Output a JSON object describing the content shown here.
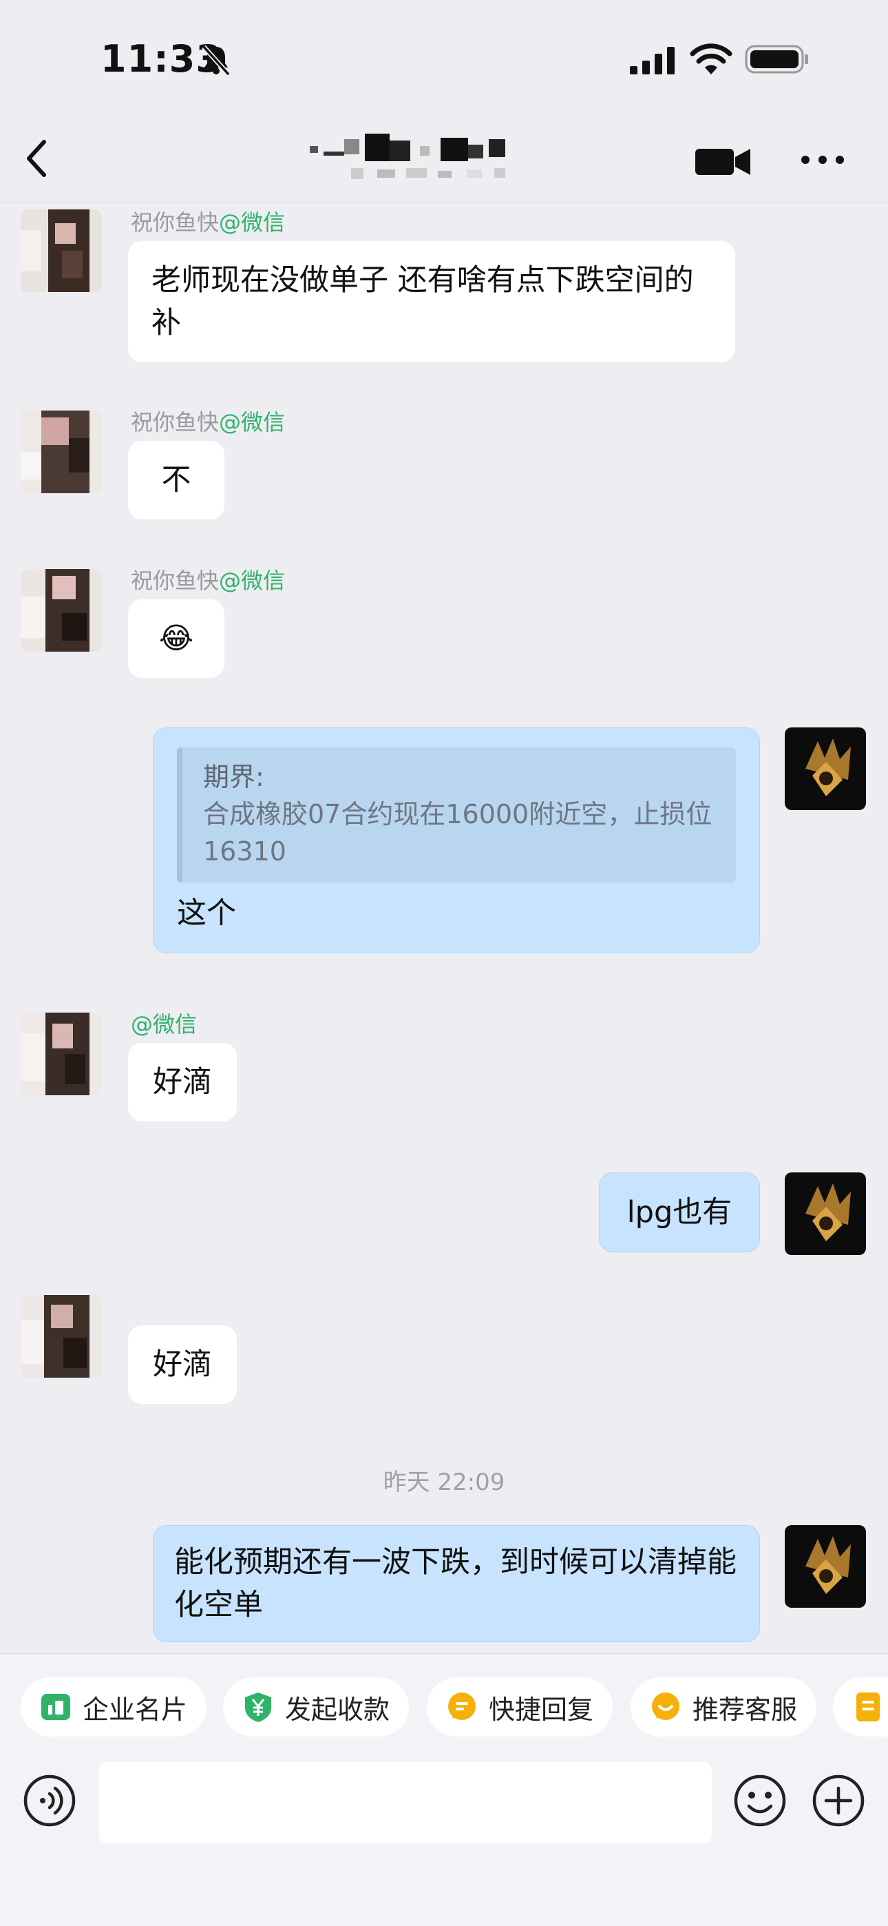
{
  "status_bar": {
    "time": "11:33"
  },
  "nav": {
    "title": ""
  },
  "messages": [
    {
      "sender": "祝你鱼快",
      "tag": "@微信",
      "text": "老师现在没做单子 还有啥有点下跌空间的补"
    },
    {
      "sender": "祝你鱼快",
      "tag": "@微信",
      "text": "不"
    },
    {
      "sender": "祝你鱼快",
      "tag": "@微信",
      "text": "😂"
    },
    {
      "quote_name": "期界:",
      "quote_text": "合成橡胶07合约现在16000附近空，止损位16310",
      "text": "这个"
    },
    {
      "sender": "",
      "tag": "@微信",
      "text": "好滴"
    },
    {
      "text": "lpg也有"
    },
    {
      "sender": "",
      "tag": "",
      "text": "好滴"
    },
    {
      "text": "能化预期还有一波下跌，到时候可以清掉能化空单"
    }
  ],
  "time_divider": "昨天 22:09",
  "quick_actions": [
    {
      "label": "企业名片",
      "icon": "id-card-icon",
      "color": "#2fb36b"
    },
    {
      "label": "发起收款",
      "icon": "yuan-shield-icon",
      "color": "#2fb36b"
    },
    {
      "label": "快捷回复",
      "icon": "reply-bubble-icon",
      "color": "#f5b10a"
    },
    {
      "label": "推荐客服",
      "icon": "service-bubble-icon",
      "color": "#f5b10a"
    }
  ],
  "colors": {
    "accent_green": "#2fb36b",
    "bubble_blue": "#c7e3fd",
    "chip_yellow": "#f5b10a"
  }
}
